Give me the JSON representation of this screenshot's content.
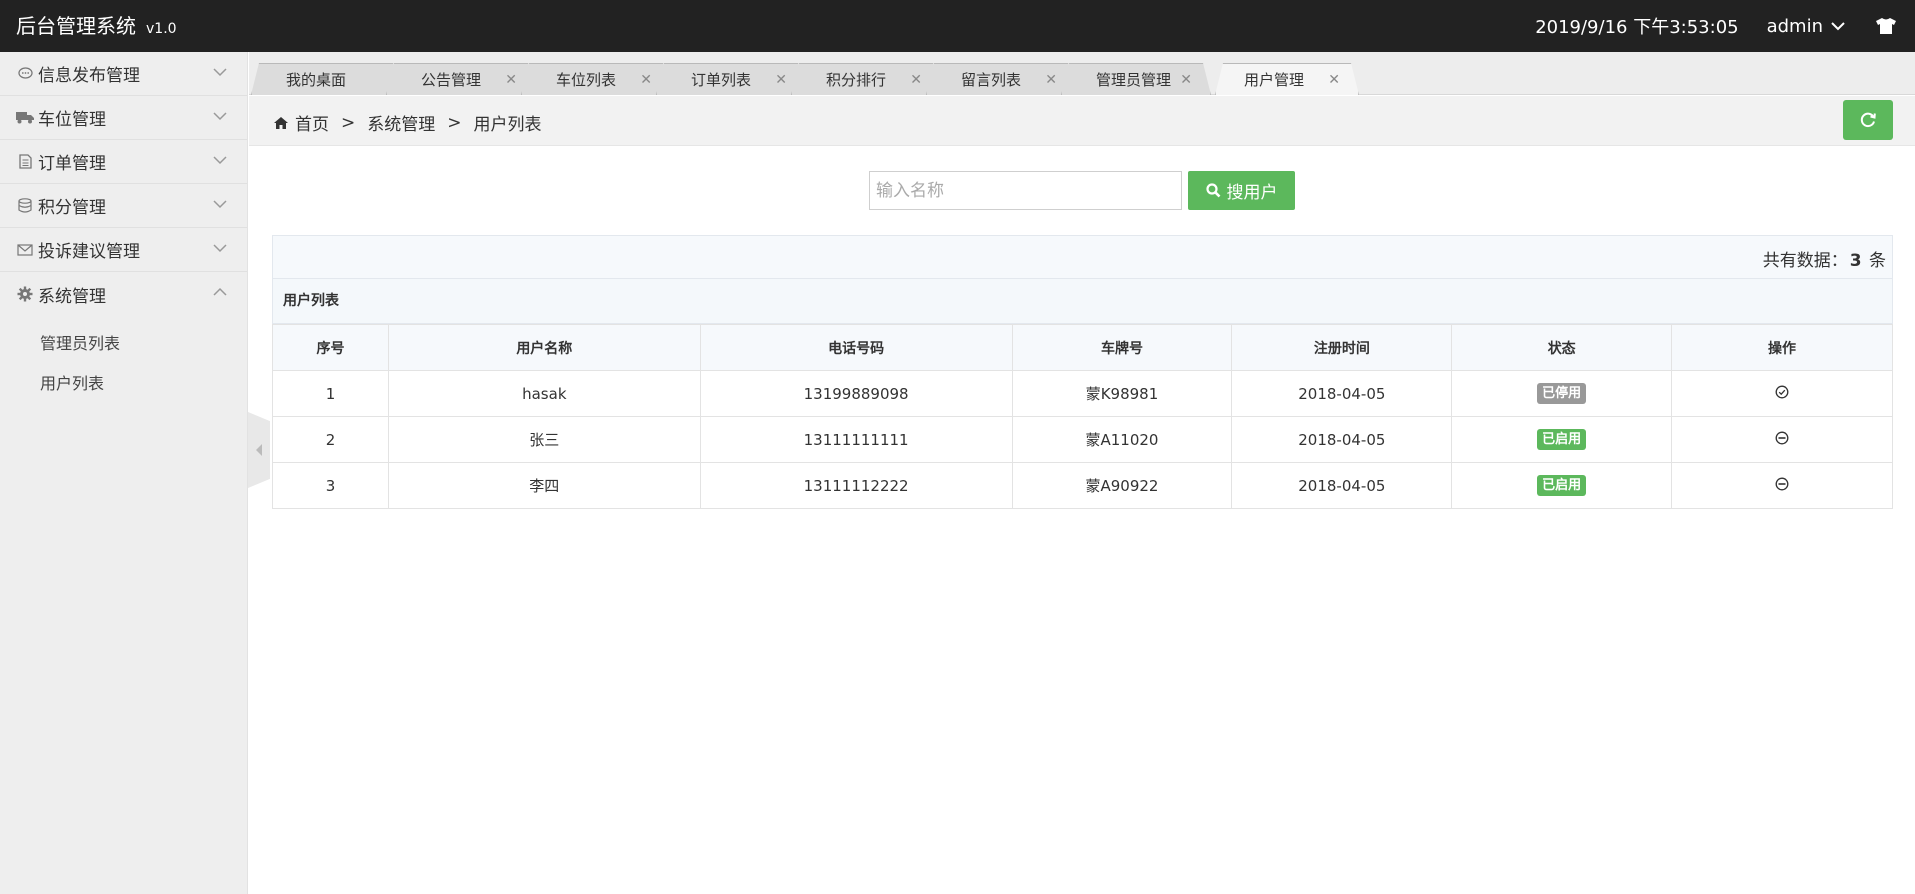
{
  "app": {
    "title": "后台管理系统",
    "version": "v1.0"
  },
  "header": {
    "datetime": "2019/9/16 下午3:53:05",
    "user": "admin"
  },
  "sidebar": {
    "items": [
      {
        "label": "信息发布管理",
        "icon": "chat-icon"
      },
      {
        "label": "车位管理",
        "icon": "truck-icon"
      },
      {
        "label": "订单管理",
        "icon": "file-icon"
      },
      {
        "label": "积分管理",
        "icon": "database-icon"
      },
      {
        "label": "投诉建议管理",
        "icon": "envelope-icon"
      },
      {
        "label": "系统管理",
        "icon": "gear-icon",
        "expanded": true
      }
    ],
    "subitems": [
      {
        "label": "管理员列表"
      },
      {
        "label": "用户列表"
      }
    ]
  },
  "tabs": [
    {
      "label": "我的桌面",
      "closable": false
    },
    {
      "label": "公告管理",
      "closable": true
    },
    {
      "label": "车位列表",
      "closable": true
    },
    {
      "label": "订单列表",
      "closable": true
    },
    {
      "label": "积分排行",
      "closable": true
    },
    {
      "label": "留言列表",
      "closable": true
    },
    {
      "label": "管理员管理",
      "closable": true
    },
    {
      "label": "用户管理",
      "closable": true,
      "active": true
    }
  ],
  "breadcrumb": {
    "home": "首页",
    "sep": ">",
    "level1": "系统管理",
    "level2": "用户列表"
  },
  "search": {
    "placeholder": "输入名称",
    "button": "搜用户"
  },
  "summary": {
    "prefix": "共有数据：",
    "count": "3",
    "suffix": "条"
  },
  "table": {
    "title": "用户列表",
    "columns": [
      "序号",
      "用户名称",
      "电话号码",
      "车牌号",
      "注册时间",
      "状态",
      "操作"
    ],
    "rows": [
      {
        "id": "1",
        "name": "hasak",
        "phone": "13199889098",
        "plate": "蒙K98981",
        "date": "2018-04-05",
        "status": "已停用"
      },
      {
        "id": "2",
        "name": "张三",
        "phone": "13111111111",
        "plate": "蒙A11020",
        "date": "2018-04-05",
        "status": "已启用"
      },
      {
        "id": "3",
        "name": "李四",
        "phone": "13111112222",
        "plate": "蒙A90922",
        "date": "2018-04-05",
        "status": "已启用"
      }
    ]
  },
  "colors": {
    "header_bg": "#222222",
    "accent_green": "#5cb85c",
    "badge_disabled": "#999999",
    "sidebar_bg": "#eeeeee"
  }
}
